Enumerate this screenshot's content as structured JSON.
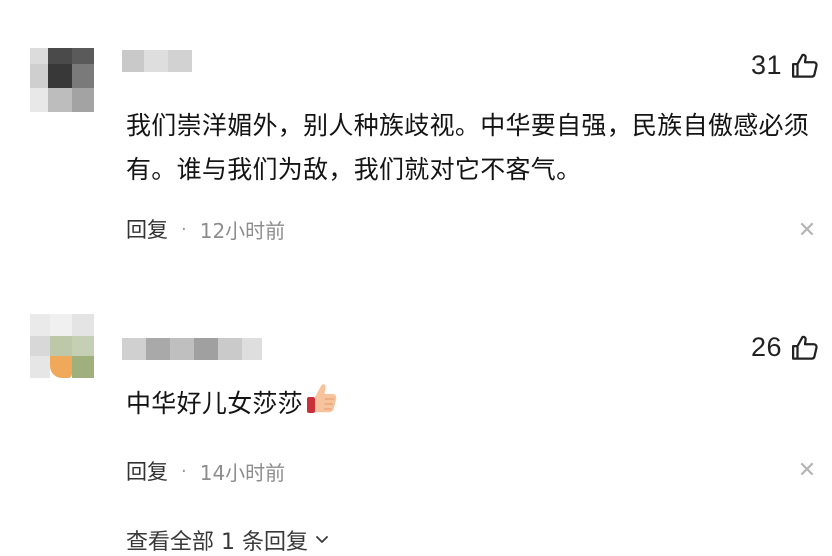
{
  "comments": [
    {
      "likes": "31",
      "text": "我们崇洋媚外，别人种族歧视。中华要自强，民族自傲感必须有。谁与我们为敌，我们就对它不客气。",
      "reply_label": "回复",
      "separator": "·",
      "time": "12小时前"
    },
    {
      "likes": "26",
      "text": "中华好儿女莎莎",
      "reply_label": "回复",
      "separator": "·",
      "time": "14小时前",
      "view_replies": "查看全部 1 条回复"
    }
  ],
  "icons": {
    "like": "thumbs-up-outline-icon",
    "close": "close-icon",
    "emoji": "thumbs-up-emoji",
    "expand": "chevron-down-icon"
  },
  "colors": {
    "text": "#141414",
    "meta": "#8d8d8d",
    "close": "#b5b5b5"
  }
}
